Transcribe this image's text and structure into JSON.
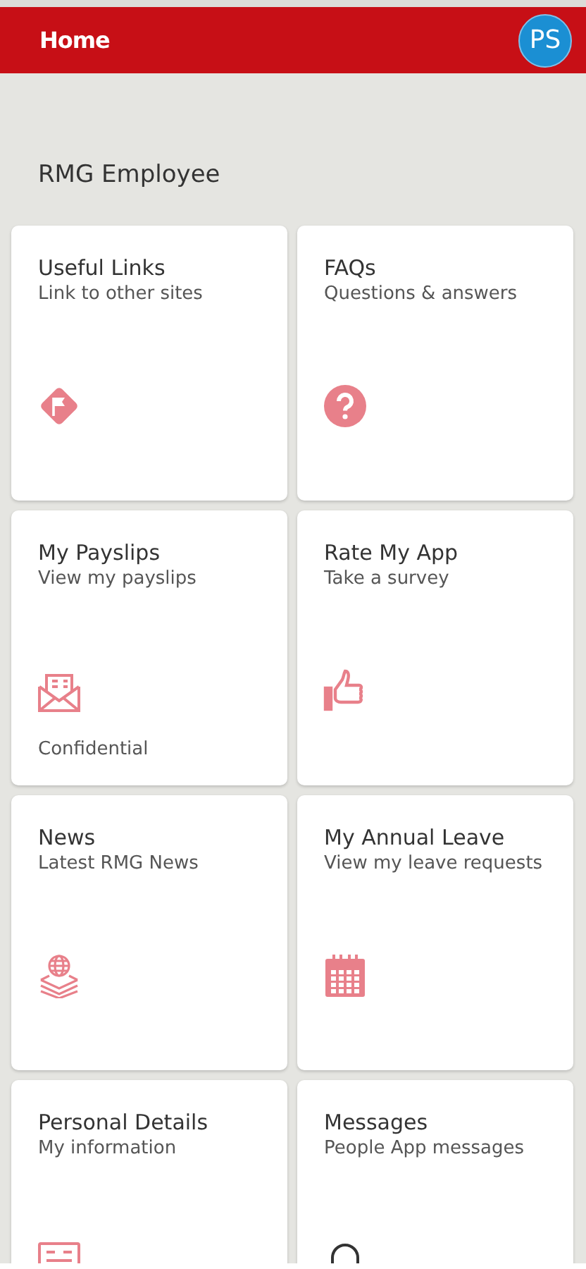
{
  "header": {
    "title": "Home",
    "avatar": "PS"
  },
  "greeting": "RMG Employee",
  "tiles": [
    {
      "title": "Useful Links",
      "subtitle": "Link to other sites"
    },
    {
      "title": "FAQs",
      "subtitle": "Questions & answers"
    },
    {
      "title": "My Payslips",
      "subtitle": "View my payslips",
      "note": "Confidential"
    },
    {
      "title": "Rate My App",
      "subtitle": "Take a survey"
    },
    {
      "title": "News",
      "subtitle": "Latest RMG News"
    },
    {
      "title": "My Annual Leave",
      "subtitle": "View my leave requests"
    },
    {
      "title": "Personal Details",
      "subtitle": "My information"
    },
    {
      "title": "Messages",
      "subtitle": "People App messages"
    }
  ]
}
